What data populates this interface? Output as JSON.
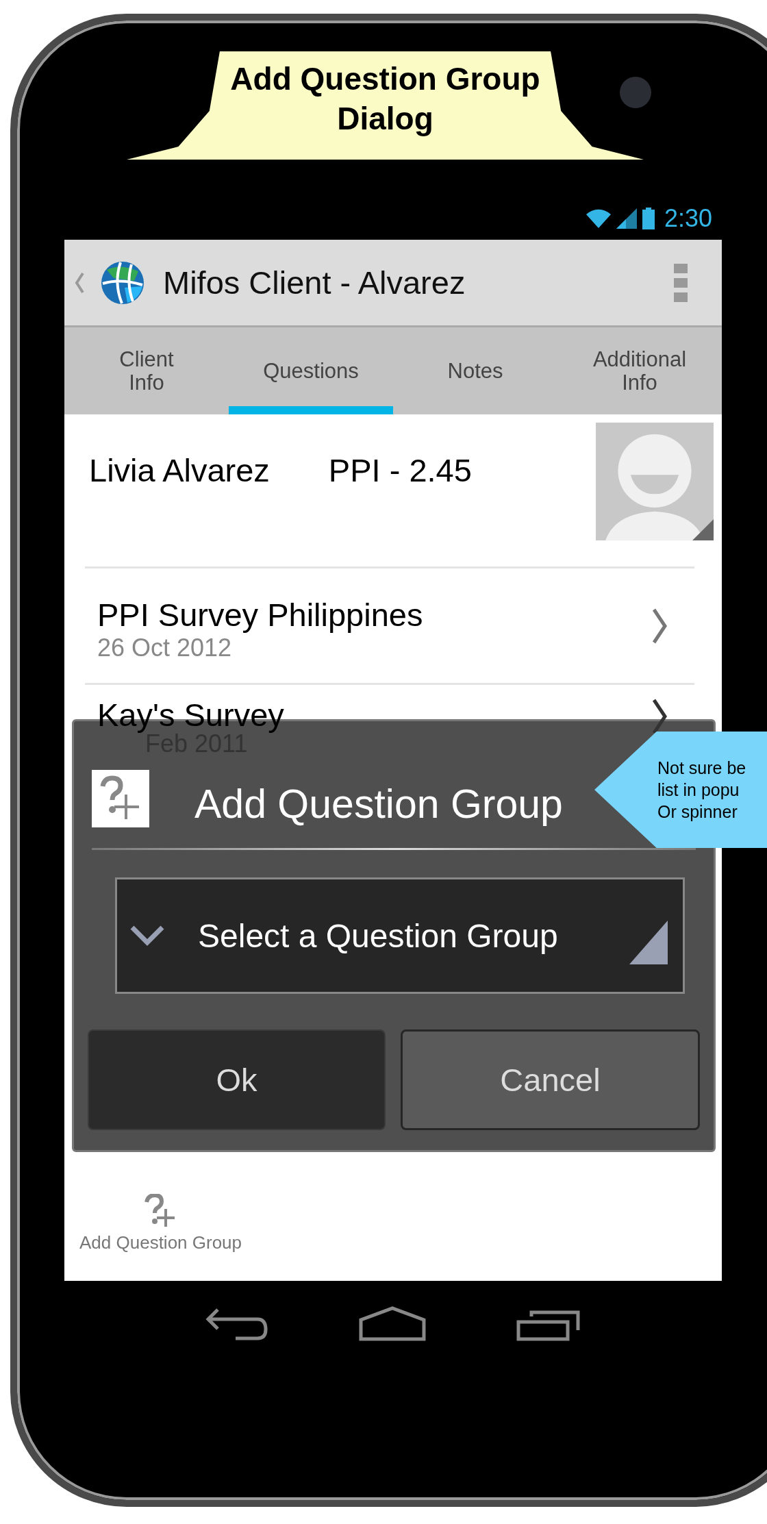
{
  "annotation": {
    "text": "Add Question Group Dialog"
  },
  "status_bar": {
    "time": "2:30"
  },
  "action_bar": {
    "title": "Mifos Client - Alvarez"
  },
  "tabs": [
    {
      "label": "Client Info",
      "selected": false
    },
    {
      "label": "Questions",
      "selected": true
    },
    {
      "label": "Notes",
      "selected": false
    },
    {
      "label": "Additional Info",
      "selected": false
    }
  ],
  "client": {
    "name": "Livia Alvarez",
    "score": "PPI - 2.45"
  },
  "surveys": [
    {
      "title": "PPI Survey Philippines",
      "date": "26 Oct 2012"
    },
    {
      "title": "Kay's Survey",
      "date": "Feb 2011"
    }
  ],
  "dialog": {
    "title": "Add Question Group",
    "spinner": {
      "placeholder": "Select a Question Group"
    },
    "buttons": [
      {
        "label": "Ok",
        "kind": "confirm"
      },
      {
        "label": "Cancel",
        "kind": "cancel"
      }
    ]
  },
  "note": {
    "lines": [
      "Not sure be",
      "list in popu",
      "Or spinner"
    ]
  },
  "bottom_action": {
    "label": "Add Question Group"
  }
}
